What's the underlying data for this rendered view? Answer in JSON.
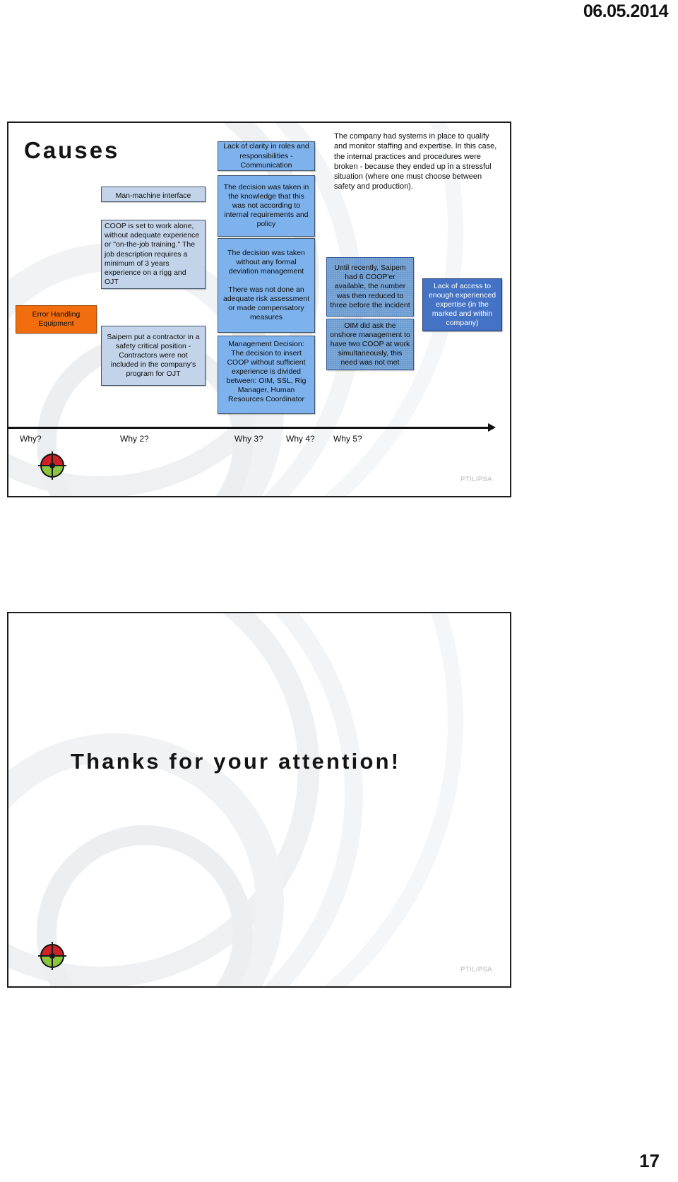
{
  "page": {
    "date": "06.05.2014",
    "number": "17"
  },
  "slide_causes": {
    "title": "Causes",
    "footer_brand": "PTIL/PSA",
    "logo_icon": "target-logo-icon",
    "trigger_box": "Error Handling Equipment",
    "column1": [
      "Man-machine interface",
      "COOP is set to work alone, without adequate experience or \"on-the-job training.\" The job description requires a minimum of 3 years experience on a rigg and OJT",
      "Saipem put a contractor in a safety critical position - Contractors were not included in the company's program for OJT"
    ],
    "column2": [
      "Lack of clarity in roles and responsibilities - Communication",
      "The decision was taken in the knowledge that this was not according to internal requirements and policy",
      "The decision was taken without any formal deviation management\n\nThere was not done an adequate risk assessment or made compensatory measures",
      "Management Decision: The decision to insert COOP without sufficient experience is divided between: OIM, SSL, Rig Manager, Human Resources Coordinator"
    ],
    "paragraph": "The company had systems in place to qualify and monitor staffing and expertise. In this case, the internal practices and procedures were broken - because they ended up in a stressful situation (where one must choose between safety and production).",
    "column3": [
      "Until recently, Saipem had 6 COOP'er available, the number was then reduced to three before the incident",
      "OIM did ask the onshore management to have two COOP at work simultaneously, this need was not met"
    ],
    "column4": [
      "Lack of access to enough experienced expertise (in the marked and within company)"
    ],
    "why_labels": [
      "Why?",
      "Why 2?",
      "Why  3?",
      "Why 4?",
      "Why 5?"
    ],
    "colors": {
      "light_blue": "#c3d4ea",
      "mid_blue": "#7eb2ec",
      "textured_blue": "#6a9bd1",
      "solid_blue": "#4472c4",
      "orange": "#f26d0d",
      "border_blue": "#44546a"
    }
  },
  "slide_thanks": {
    "title": "Thanks for your attention!",
    "footer_brand": "PTIL/PSA",
    "logo_icon": "target-logo-icon"
  }
}
